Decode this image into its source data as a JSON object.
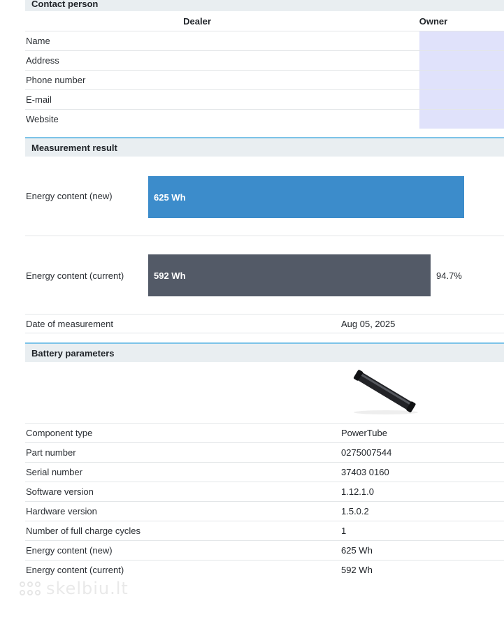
{
  "contact": {
    "title": "Contact person",
    "col_dealer": "Dealer",
    "col_owner": "Owner",
    "rows": [
      "Name",
      "Address",
      "Phone number",
      "E-mail",
      "Website"
    ]
  },
  "measurement": {
    "title": "Measurement result",
    "new_label": "Energy content (new)",
    "new_value": "625 Wh",
    "new_fraction": 1.0,
    "current_label": "Energy content (current)",
    "current_value": "592 Wh",
    "current_fraction": 0.947,
    "current_percent": "94.7%",
    "date_label": "Date of measurement",
    "date_value": "Aug 05, 2025"
  },
  "battery": {
    "title": "Battery parameters",
    "rows": [
      {
        "label": "Component type",
        "value": "PowerTube"
      },
      {
        "label": "Part number",
        "value": "0275007544"
      },
      {
        "label": "Serial number",
        "value": "37403 0160"
      },
      {
        "label": "Software version",
        "value": "1.12.1.0"
      },
      {
        "label": "Hardware version",
        "value": "1.5.0.2"
      },
      {
        "label": "Number of full charge cycles",
        "value": "1"
      },
      {
        "label": "Energy content (new)",
        "value": "625 Wh"
      },
      {
        "label": "Energy content (current)",
        "value": "592 Wh"
      }
    ]
  },
  "watermark": "skelbiu.lt",
  "colors": {
    "bar_new": "#3c8ccb",
    "bar_current": "#535a67",
    "owner_fill": "#e0e2fb",
    "section_bg": "#e9eef1",
    "section_line": "#7cc3e8"
  }
}
